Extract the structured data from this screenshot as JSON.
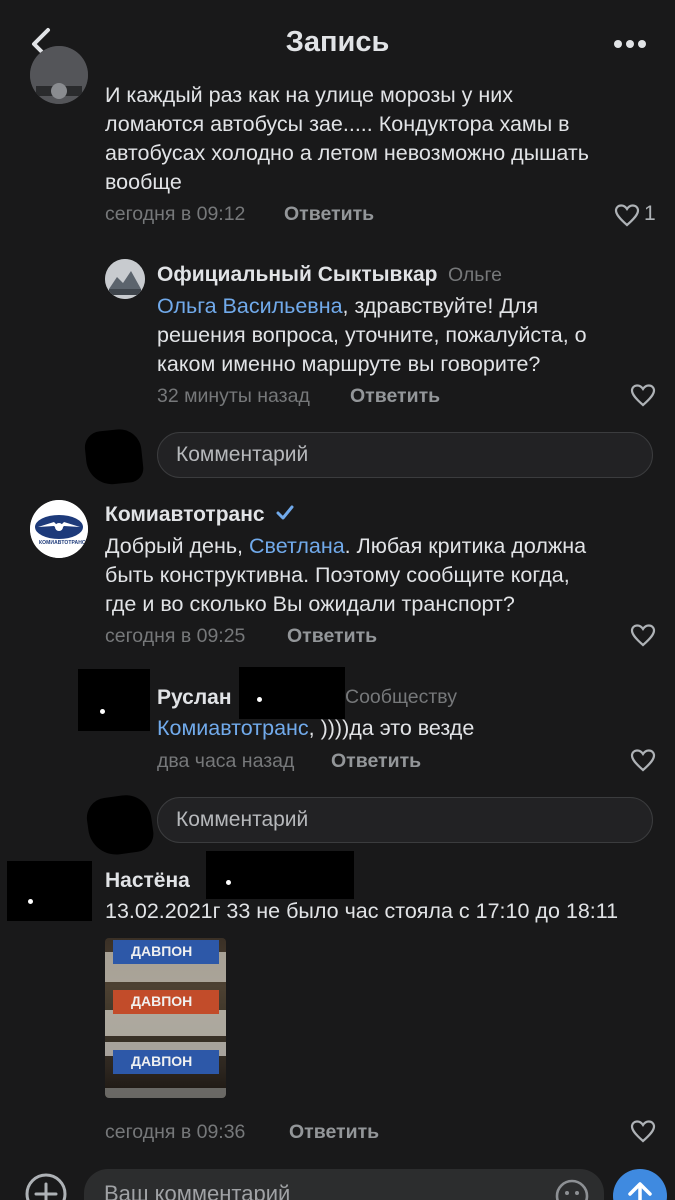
{
  "header": {
    "title": "Запись",
    "back_icon": "chevron-left-icon",
    "more_icon": "more-horizontal-icon"
  },
  "comments": [
    {
      "text_lines": [
        "И каждый раз как на улице морозы у них",
        "ломаются автобусы зае..... Кондуктора хамы в",
        "автобусах холодно а летом невозможно дышать",
        "вообще"
      ],
      "time": "сегодня в 09:12",
      "reply_label": "Ответить",
      "likes": "1"
    },
    {
      "author": "Официальный Сыктывкар",
      "addressee": "Ольге",
      "mention": "Ольга Васильевна",
      "text_first": ", здравствуйте! Для",
      "text_lines": [
        "решения вопроса, уточните, пожалуйста, о",
        "каком именно маршруте вы говорите?"
      ],
      "time": "32 минуты назад",
      "reply_label": "Ответить"
    },
    {
      "author": "Комиавтотранс",
      "verified_icon": "verified-check-icon",
      "logo_text": "КОМИАВТОТРАНС",
      "line1_before": "Добрый день, ",
      "mention": "Светлана",
      "line1_after": ". Любая критика должна",
      "text_lines": [
        "быть конструктивна. Поэтому сообщите когда,",
        "где и во сколько Вы ожидали транспорт?"
      ],
      "time": "сегодня в 09:25",
      "reply_label": "Ответить"
    },
    {
      "author": "Руслан",
      "addressee": "Сообществу",
      "mention": "Комиавтотранс",
      "text_after": ", ))))да это везде",
      "time": "два часа назад",
      "reply_label": "Ответить"
    },
    {
      "author": "Настёна",
      "text": "13.02.2021г  33 не было час стояла с 17:10 до 18:11",
      "photo_plates": [
        "ДАВПОН",
        "ДАВПОН",
        "ДАВПОН"
      ],
      "time": "сегодня в 09:36",
      "reply_label": "Ответить"
    }
  ],
  "reply_inputs": [
    {
      "placeholder": "Комментарий"
    },
    {
      "placeholder": "Комментарий"
    }
  ],
  "composer": {
    "placeholder": "Ваш комментарий",
    "add_icon": "plus-circle-icon",
    "emoji_icon": "smile-icon",
    "send_icon": "arrow-up-icon"
  },
  "colors": {
    "background": "#19191a",
    "link": "#71aaeb",
    "send": "#3f8ae0"
  }
}
